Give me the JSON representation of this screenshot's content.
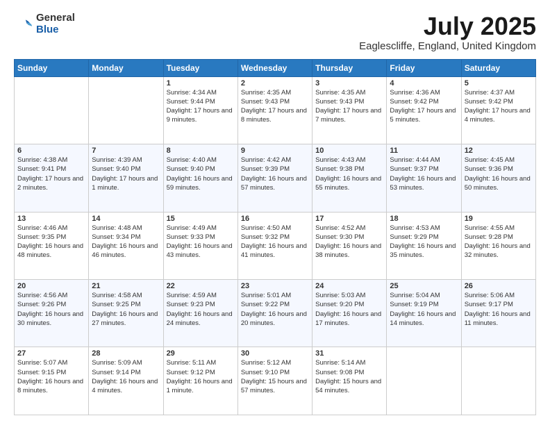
{
  "logo": {
    "general": "General",
    "blue": "Blue"
  },
  "title": "July 2025",
  "subtitle": "Eaglescliffe, England, United Kingdom",
  "days_of_week": [
    "Sunday",
    "Monday",
    "Tuesday",
    "Wednesday",
    "Thursday",
    "Friday",
    "Saturday"
  ],
  "weeks": [
    [
      {
        "day": "",
        "sunrise": "",
        "sunset": "",
        "daylight": ""
      },
      {
        "day": "",
        "sunrise": "",
        "sunset": "",
        "daylight": ""
      },
      {
        "day": "1",
        "sunrise": "Sunrise: 4:34 AM",
        "sunset": "Sunset: 9:44 PM",
        "daylight": "Daylight: 17 hours and 9 minutes."
      },
      {
        "day": "2",
        "sunrise": "Sunrise: 4:35 AM",
        "sunset": "Sunset: 9:43 PM",
        "daylight": "Daylight: 17 hours and 8 minutes."
      },
      {
        "day": "3",
        "sunrise": "Sunrise: 4:35 AM",
        "sunset": "Sunset: 9:43 PM",
        "daylight": "Daylight: 17 hours and 7 minutes."
      },
      {
        "day": "4",
        "sunrise": "Sunrise: 4:36 AM",
        "sunset": "Sunset: 9:42 PM",
        "daylight": "Daylight: 17 hours and 5 minutes."
      },
      {
        "day": "5",
        "sunrise": "Sunrise: 4:37 AM",
        "sunset": "Sunset: 9:42 PM",
        "daylight": "Daylight: 17 hours and 4 minutes."
      }
    ],
    [
      {
        "day": "6",
        "sunrise": "Sunrise: 4:38 AM",
        "sunset": "Sunset: 9:41 PM",
        "daylight": "Daylight: 17 hours and 2 minutes."
      },
      {
        "day": "7",
        "sunrise": "Sunrise: 4:39 AM",
        "sunset": "Sunset: 9:40 PM",
        "daylight": "Daylight: 17 hours and 1 minute."
      },
      {
        "day": "8",
        "sunrise": "Sunrise: 4:40 AM",
        "sunset": "Sunset: 9:40 PM",
        "daylight": "Daylight: 16 hours and 59 minutes."
      },
      {
        "day": "9",
        "sunrise": "Sunrise: 4:42 AM",
        "sunset": "Sunset: 9:39 PM",
        "daylight": "Daylight: 16 hours and 57 minutes."
      },
      {
        "day": "10",
        "sunrise": "Sunrise: 4:43 AM",
        "sunset": "Sunset: 9:38 PM",
        "daylight": "Daylight: 16 hours and 55 minutes."
      },
      {
        "day": "11",
        "sunrise": "Sunrise: 4:44 AM",
        "sunset": "Sunset: 9:37 PM",
        "daylight": "Daylight: 16 hours and 53 minutes."
      },
      {
        "day": "12",
        "sunrise": "Sunrise: 4:45 AM",
        "sunset": "Sunset: 9:36 PM",
        "daylight": "Daylight: 16 hours and 50 minutes."
      }
    ],
    [
      {
        "day": "13",
        "sunrise": "Sunrise: 4:46 AM",
        "sunset": "Sunset: 9:35 PM",
        "daylight": "Daylight: 16 hours and 48 minutes."
      },
      {
        "day": "14",
        "sunrise": "Sunrise: 4:48 AM",
        "sunset": "Sunset: 9:34 PM",
        "daylight": "Daylight: 16 hours and 46 minutes."
      },
      {
        "day": "15",
        "sunrise": "Sunrise: 4:49 AM",
        "sunset": "Sunset: 9:33 PM",
        "daylight": "Daylight: 16 hours and 43 minutes."
      },
      {
        "day": "16",
        "sunrise": "Sunrise: 4:50 AM",
        "sunset": "Sunset: 9:32 PM",
        "daylight": "Daylight: 16 hours and 41 minutes."
      },
      {
        "day": "17",
        "sunrise": "Sunrise: 4:52 AM",
        "sunset": "Sunset: 9:30 PM",
        "daylight": "Daylight: 16 hours and 38 minutes."
      },
      {
        "day": "18",
        "sunrise": "Sunrise: 4:53 AM",
        "sunset": "Sunset: 9:29 PM",
        "daylight": "Daylight: 16 hours and 35 minutes."
      },
      {
        "day": "19",
        "sunrise": "Sunrise: 4:55 AM",
        "sunset": "Sunset: 9:28 PM",
        "daylight": "Daylight: 16 hours and 32 minutes."
      }
    ],
    [
      {
        "day": "20",
        "sunrise": "Sunrise: 4:56 AM",
        "sunset": "Sunset: 9:26 PM",
        "daylight": "Daylight: 16 hours and 30 minutes."
      },
      {
        "day": "21",
        "sunrise": "Sunrise: 4:58 AM",
        "sunset": "Sunset: 9:25 PM",
        "daylight": "Daylight: 16 hours and 27 minutes."
      },
      {
        "day": "22",
        "sunrise": "Sunrise: 4:59 AM",
        "sunset": "Sunset: 9:23 PM",
        "daylight": "Daylight: 16 hours and 24 minutes."
      },
      {
        "day": "23",
        "sunrise": "Sunrise: 5:01 AM",
        "sunset": "Sunset: 9:22 PM",
        "daylight": "Daylight: 16 hours and 20 minutes."
      },
      {
        "day": "24",
        "sunrise": "Sunrise: 5:03 AM",
        "sunset": "Sunset: 9:20 PM",
        "daylight": "Daylight: 16 hours and 17 minutes."
      },
      {
        "day": "25",
        "sunrise": "Sunrise: 5:04 AM",
        "sunset": "Sunset: 9:19 PM",
        "daylight": "Daylight: 16 hours and 14 minutes."
      },
      {
        "day": "26",
        "sunrise": "Sunrise: 5:06 AM",
        "sunset": "Sunset: 9:17 PM",
        "daylight": "Daylight: 16 hours and 11 minutes."
      }
    ],
    [
      {
        "day": "27",
        "sunrise": "Sunrise: 5:07 AM",
        "sunset": "Sunset: 9:15 PM",
        "daylight": "Daylight: 16 hours and 8 minutes."
      },
      {
        "day": "28",
        "sunrise": "Sunrise: 5:09 AM",
        "sunset": "Sunset: 9:14 PM",
        "daylight": "Daylight: 16 hours and 4 minutes."
      },
      {
        "day": "29",
        "sunrise": "Sunrise: 5:11 AM",
        "sunset": "Sunset: 9:12 PM",
        "daylight": "Daylight: 16 hours and 1 minute."
      },
      {
        "day": "30",
        "sunrise": "Sunrise: 5:12 AM",
        "sunset": "Sunset: 9:10 PM",
        "daylight": "Daylight: 15 hours and 57 minutes."
      },
      {
        "day": "31",
        "sunrise": "Sunrise: 5:14 AM",
        "sunset": "Sunset: 9:08 PM",
        "daylight": "Daylight: 15 hours and 54 minutes."
      },
      {
        "day": "",
        "sunrise": "",
        "sunset": "",
        "daylight": ""
      },
      {
        "day": "",
        "sunrise": "",
        "sunset": "",
        "daylight": ""
      }
    ]
  ]
}
